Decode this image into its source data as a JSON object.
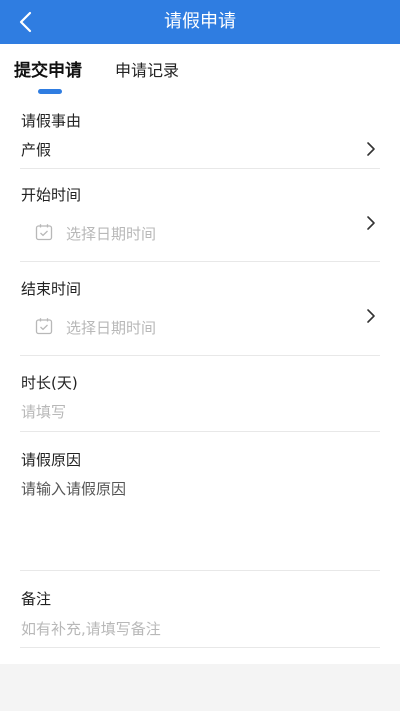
{
  "header": {
    "title": "请假申请",
    "back_icon": "chevron-left-icon"
  },
  "tabs": [
    {
      "label": "提交申请",
      "active": true
    },
    {
      "label": "申请记录",
      "active": false
    }
  ],
  "colors": {
    "primary": "#2f7de1",
    "placeholder": "#b8b8b8"
  },
  "form": {
    "leave_type": {
      "label": "请假事由",
      "value": "产假"
    },
    "start_time": {
      "label": "开始时间",
      "placeholder": "选择日期时间"
    },
    "end_time": {
      "label": "结束时间",
      "placeholder": "选择日期时间"
    },
    "duration": {
      "label": "时长(天)",
      "placeholder": "请填写"
    },
    "reason": {
      "label": "请假原因",
      "placeholder": "请输入请假原因"
    },
    "remark": {
      "label": "备注",
      "placeholder": "如有补充,请填写备注"
    }
  }
}
